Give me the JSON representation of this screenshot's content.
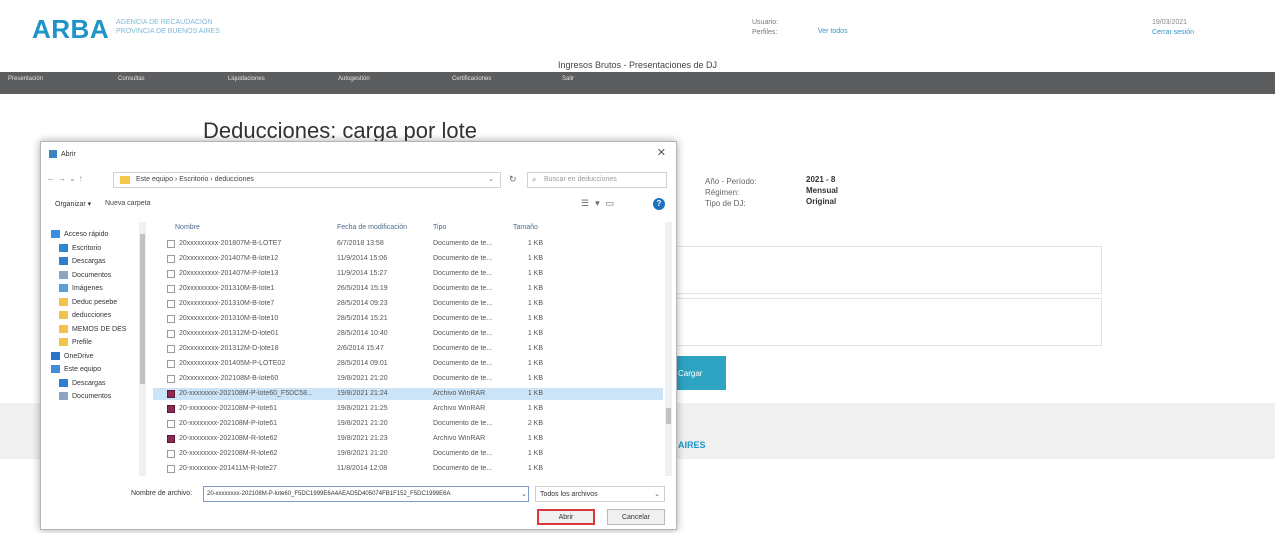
{
  "header": {
    "logo": "ARBA",
    "logo_sub_1": "AGENCIA DE RECAUDACIÓN",
    "logo_sub_2": "PROVINCIA DE BUENOS AIRES",
    "user_label": "Usuario:",
    "profile_label": "Perfiles:",
    "profile_link": "Ver todos",
    "date": "19/03/2021",
    "logout": "Cerrar sesión"
  },
  "app_title": "Ingresos Brutos - Presentaciones de DJ",
  "nav": {
    "items": [
      "Presentación",
      "Consultas",
      "Liquidaciones",
      "Autogestión",
      "Certificaciones",
      "Salir"
    ]
  },
  "page_title": "Deducciones: carga por lote",
  "info": {
    "labels": [
      "Año - Período:",
      "Régimen:",
      "Tipo de DJ:"
    ],
    "values": [
      "2021 - 8",
      "Mensual",
      "Original"
    ]
  },
  "cargar_label": "Cargar",
  "footer_brand": "AIRES",
  "dialog": {
    "title": "Abrir",
    "address": "Este equipo  ›  Escritorio  ›  deducciones",
    "search_placeholder": "Buscar en deducciones",
    "organize": "Organizar ▾",
    "new_folder": "Nueva carpeta",
    "nav_items": [
      {
        "label": "Acceso rápido",
        "color": "#3a8de0"
      },
      {
        "label": "Escritorio",
        "color": "#2e86d6"
      },
      {
        "label": "Descargas",
        "color": "#2f7fd0"
      },
      {
        "label": "Documentos",
        "color": "#8aa6c2"
      },
      {
        "label": "Imágenes",
        "color": "#5aa0d8"
      },
      {
        "label": "Deduc pesebe",
        "color": "#f1c34c"
      },
      {
        "label": "deducciones",
        "color": "#f1c34c"
      },
      {
        "label": "MEMOS DE DES",
        "color": "#f1c34c"
      },
      {
        "label": "Prefile",
        "color": "#f1c34c"
      },
      {
        "label": "OneDrive",
        "color": "#2b74c8"
      },
      {
        "label": "Este equipo",
        "color": "#3f8ddb"
      },
      {
        "label": "Descargas",
        "color": "#2f7fd0"
      },
      {
        "label": "Documentos",
        "color": "#8aa6c2"
      }
    ],
    "columns": [
      "Nombre",
      "Fecha de modificación",
      "Tipo",
      "Tamaño"
    ],
    "files": [
      {
        "name": "20xxxxxxxxx-201807M-B-LOTE7",
        "date": "6/7/2018 13:58",
        "type": "Documento de te...",
        "size": "1 KB",
        "rar": false,
        "selected": false
      },
      {
        "name": "20xxxxxxxxx-201407M-B-lote12",
        "date": "11/9/2014 15:06",
        "type": "Documento de te...",
        "size": "1 KB",
        "rar": false,
        "selected": false
      },
      {
        "name": "20xxxxxxxxx-201407M-P-lote13",
        "date": "11/9/2014 15:27",
        "type": "Documento de te...",
        "size": "1 KB",
        "rar": false,
        "selected": false
      },
      {
        "name": "20xxxxxxxxx-201310M-B-lote1",
        "date": "26/5/2014 15:19",
        "type": "Documento de te...",
        "size": "1 KB",
        "rar": false,
        "selected": false
      },
      {
        "name": "20xxxxxxxxx-201310M-B-lote7",
        "date": "28/5/2014 09:23",
        "type": "Documento de te...",
        "size": "1 KB",
        "rar": false,
        "selected": false
      },
      {
        "name": "20xxxxxxxxx-201310M-B-lote10",
        "date": "28/5/2014 15:21",
        "type": "Documento de te...",
        "size": "1 KB",
        "rar": false,
        "selected": false
      },
      {
        "name": "20xxxxxxxxx-201312M-D-lote01",
        "date": "28/5/2014 10:40",
        "type": "Documento de te...",
        "size": "1 KB",
        "rar": false,
        "selected": false
      },
      {
        "name": "20xxxxxxxxx-201312M-D-lote18",
        "date": "2/6/2014 15:47",
        "type": "Documento de te...",
        "size": "1 KB",
        "rar": false,
        "selected": false
      },
      {
        "name": "20xxxxxxxxx-201405M-P-LOTE02",
        "date": "28/5/2014 09:01",
        "type": "Documento de te...",
        "size": "1 KB",
        "rar": false,
        "selected": false
      },
      {
        "name": "20xxxxxxxxx-202108M-B-lote60",
        "date": "19/8/2021 21:20",
        "type": "Documento de te...",
        "size": "1 KB",
        "rar": false,
        "selected": false
      },
      {
        "name": "20-xxxxxxxx-202108M-P-lote60_F5DC58...",
        "date": "19/8/2021 21:24",
        "type": "Archivo WinRAR",
        "size": "1 KB",
        "rar": true,
        "selected": true
      },
      {
        "name": "20-xxxxxxxx-202108M-P-lote61",
        "date": "19/8/2021 21:25",
        "type": "Archivo WinRAR",
        "size": "1 KB",
        "rar": true,
        "selected": false
      },
      {
        "name": "20-xxxxxxxx-202108M-P-lote61",
        "date": "19/8/2021 21:20",
        "type": "Documento de te...",
        "size": "2 KB",
        "rar": false,
        "selected": false
      },
      {
        "name": "20-xxxxxxxx-202108M-R-lote62",
        "date": "19/8/2021 21:23",
        "type": "Archivo WinRAR",
        "size": "1 KB",
        "rar": true,
        "selected": false
      },
      {
        "name": "20-xxxxxxxx-202108M-R-lote62",
        "date": "19/8/2021 21:20",
        "type": "Documento de te...",
        "size": "1 KB",
        "rar": false,
        "selected": false
      },
      {
        "name": "20-xxxxxxxx-201411M-R-lote27",
        "date": "11/8/2014 12:08",
        "type": "Documento de te...",
        "size": "1 KB",
        "rar": false,
        "selected": false
      }
    ],
    "filename_label": "Nombre de archivo:",
    "filename_value": "20-xxxxxxxx-202108M-P-lote60_F5DC1999E6A4AEAD5D405074FB1F152_F5DC1999E6A",
    "filetype": "Todos los archivos",
    "open": "Abrir",
    "cancel": "Cancelar"
  }
}
